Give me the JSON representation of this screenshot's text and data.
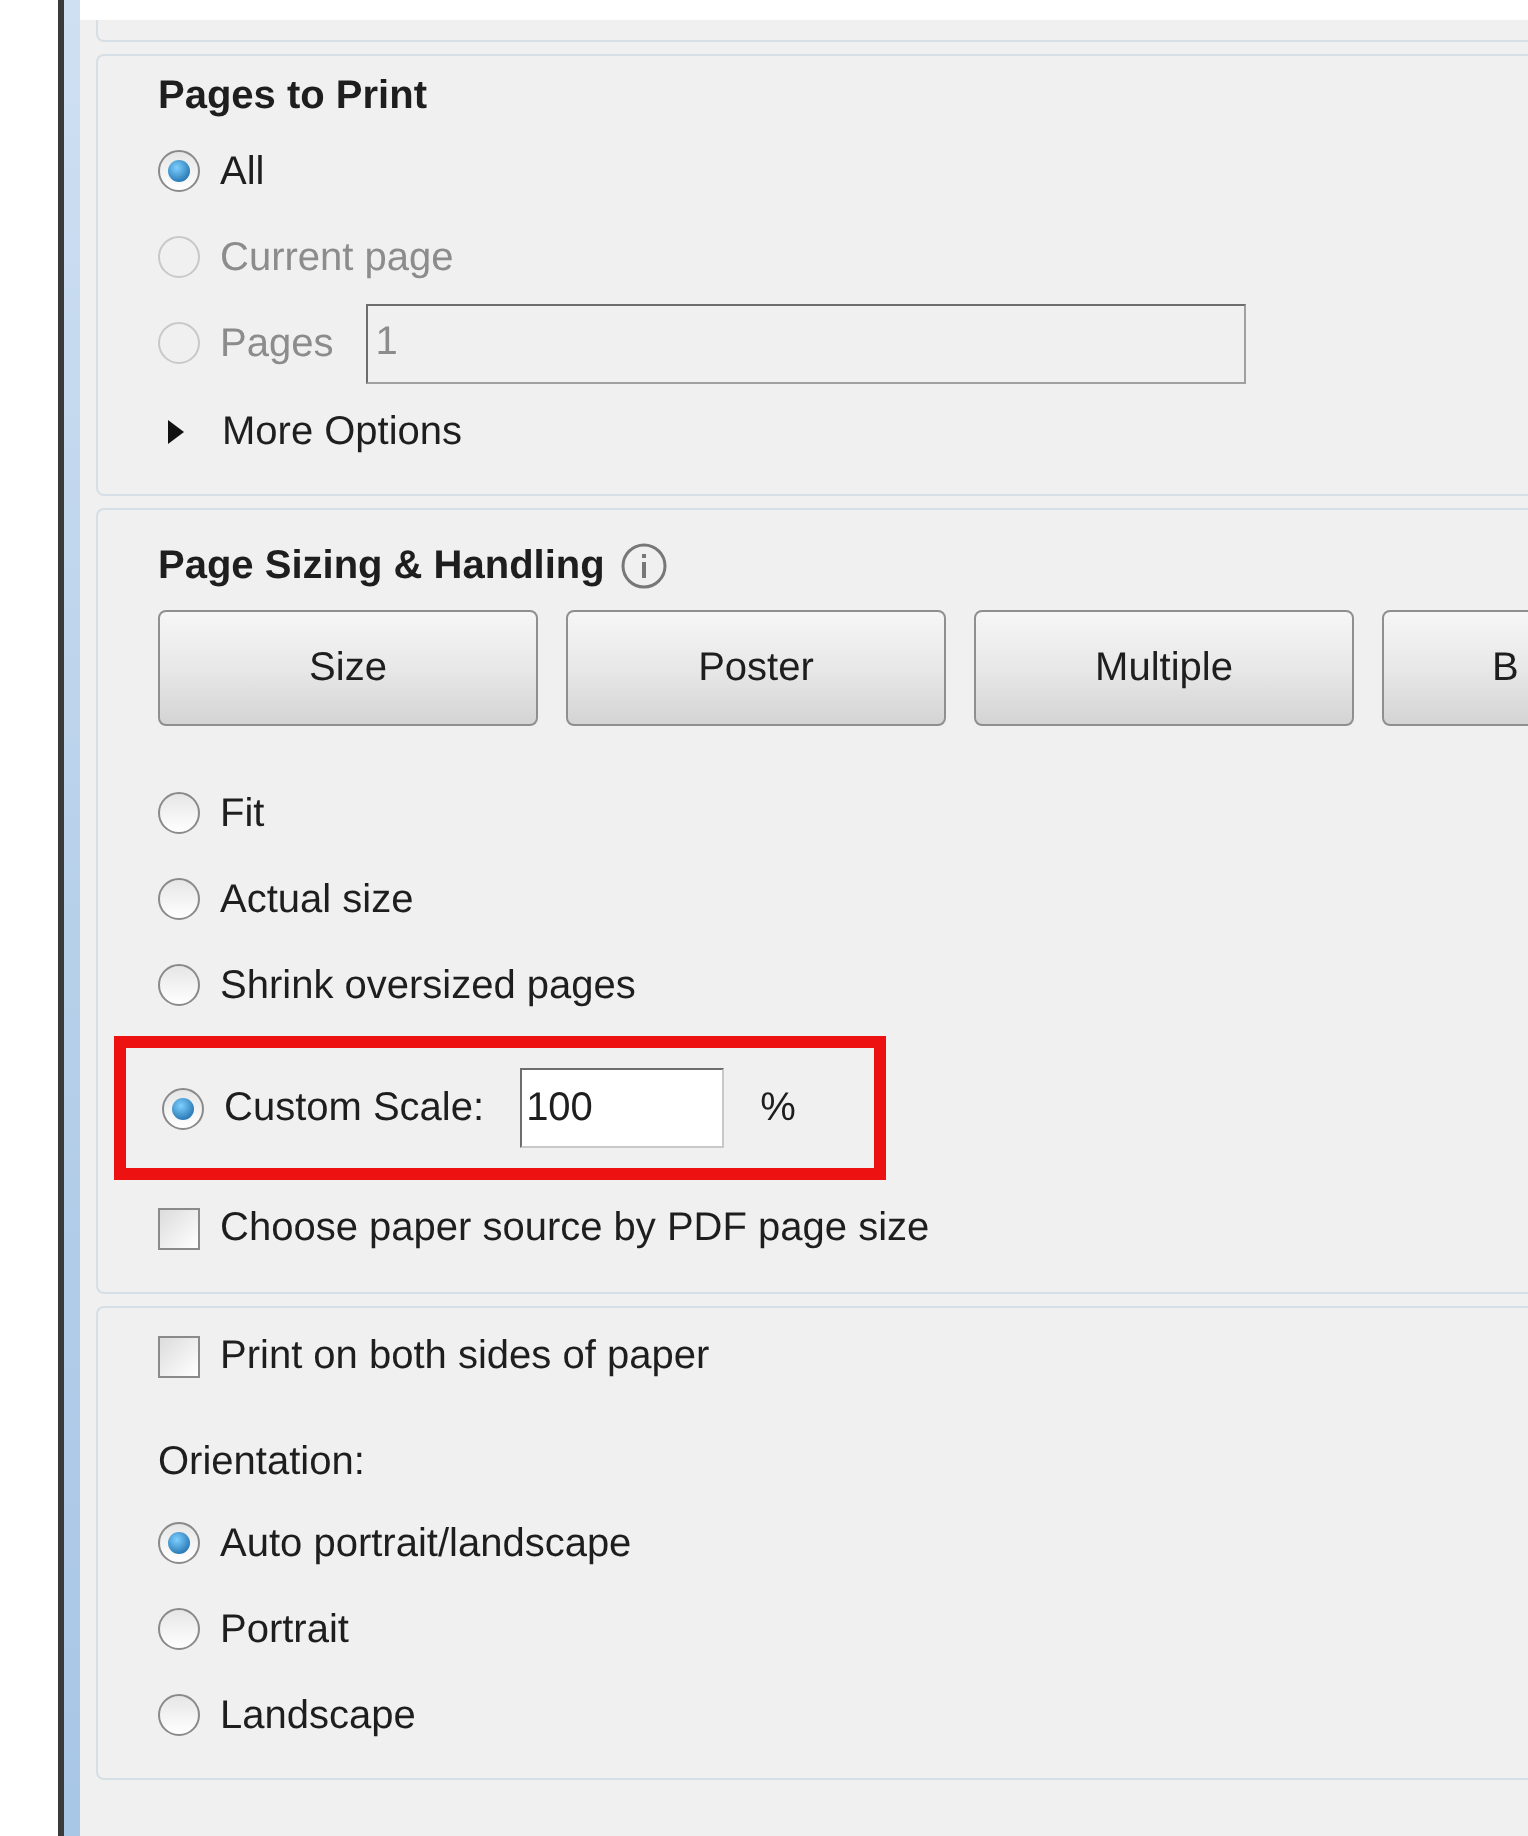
{
  "pages_to_print": {
    "title": "Pages to Print",
    "options": [
      {
        "kind": "radio",
        "label": "All",
        "selected": true,
        "disabled": false
      },
      {
        "kind": "radio",
        "label": "Current page",
        "selected": false,
        "disabled": true
      },
      {
        "kind": "field",
        "label": "Pages",
        "value": "1",
        "selected": false,
        "disabled": true
      }
    ],
    "more_options": {
      "label": "More Options",
      "expanded": false
    }
  },
  "page_sizing": {
    "title": "Page Sizing & Handling",
    "buttons": [
      "Size",
      "Poster",
      "Multiple",
      "B"
    ],
    "options": [
      {
        "kind": "radio",
        "label": "Fit",
        "selected": false
      },
      {
        "kind": "radio",
        "label": "Actual size",
        "selected": false
      },
      {
        "kind": "radio",
        "label": "Shrink oversized pages",
        "selected": false
      },
      {
        "kind": "scale",
        "label": "Custom Scale:",
        "value": "100",
        "unit": "%",
        "selected": true,
        "highlighted": true
      },
      {
        "kind": "checkbox",
        "label": "Choose paper source by PDF page size",
        "checked": false
      }
    ]
  },
  "duplex": {
    "label": "Print on both sides of paper",
    "checked": false
  },
  "orientation": {
    "title": "Orientation:",
    "options": [
      {
        "label": "Auto portrait/landscape",
        "selected": true
      },
      {
        "label": "Portrait",
        "selected": false
      },
      {
        "label": "Landscape",
        "selected": false
      }
    ]
  }
}
